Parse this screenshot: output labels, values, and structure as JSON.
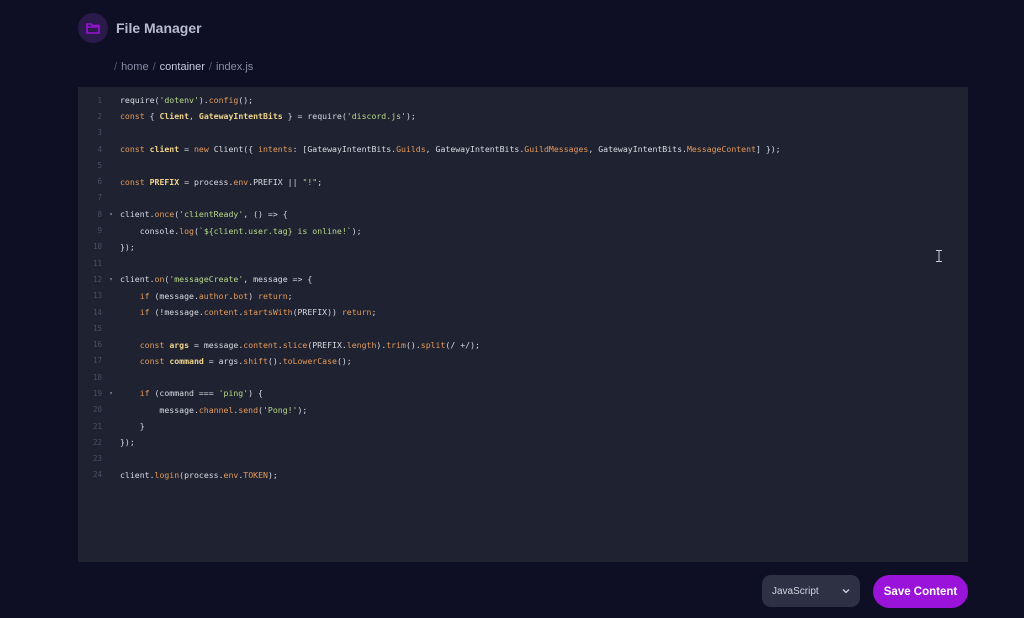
{
  "header": {
    "title": "File Manager",
    "icon": "folder-icon",
    "accent": "#9a13d8"
  },
  "breadcrumb": {
    "sep": "/",
    "items": [
      "home",
      "container",
      "index.js"
    ]
  },
  "editor": {
    "lines": [
      {
        "n": "1",
        "fold": false
      },
      {
        "n": "2",
        "fold": false
      },
      {
        "n": "3",
        "fold": false
      },
      {
        "n": "4",
        "fold": false
      },
      {
        "n": "5",
        "fold": false
      },
      {
        "n": "6",
        "fold": false
      },
      {
        "n": "7",
        "fold": false
      },
      {
        "n": "8",
        "fold": true
      },
      {
        "n": "9",
        "fold": false
      },
      {
        "n": "10",
        "fold": false
      },
      {
        "n": "11",
        "fold": false
      },
      {
        "n": "12",
        "fold": true
      },
      {
        "n": "13",
        "fold": false
      },
      {
        "n": "14",
        "fold": false
      },
      {
        "n": "15",
        "fold": false
      },
      {
        "n": "16",
        "fold": false
      },
      {
        "n": "17",
        "fold": false
      },
      {
        "n": "18",
        "fold": false
      },
      {
        "n": "19",
        "fold": true
      },
      {
        "n": "20",
        "fold": false
      },
      {
        "n": "21",
        "fold": false
      },
      {
        "n": "22",
        "fold": false
      },
      {
        "n": "23",
        "fold": false
      },
      {
        "n": "24",
        "fold": false
      }
    ],
    "code": [
      "require('dotenv').config();",
      "const { Client, GatewayIntentBits } = require('discord.js');",
      "",
      "const client = new Client({ intents: [GatewayIntentBits.Guilds, GatewayIntentBits.GuildMessages, GatewayIntentBits.MessageContent] });",
      "",
      "const PREFIX = process.env.PREFIX || \"!\";",
      "",
      "client.once('clientReady', () => {",
      "    console.log(`${client.user.tag} is online!`);",
      "});",
      "",
      "client.on('messageCreate', message => {",
      "    if (message.author.bot) return;",
      "    if (!message.content.startsWith(PREFIX)) return;",
      "",
      "    const args = message.content.slice(PREFIX.length).trim().split(/ +/);",
      "    const command = args.shift().toLowerCase();",
      "",
      "    if (command === 'ping') {",
      "        message.channel.send('Pong!');",
      "    }",
      "});",
      "",
      "client.login(process.env.TOKEN);"
    ]
  },
  "language": {
    "selected": "JavaScript",
    "icon": "chevron-down-icon"
  },
  "save_button": {
    "label": "Save Content"
  }
}
